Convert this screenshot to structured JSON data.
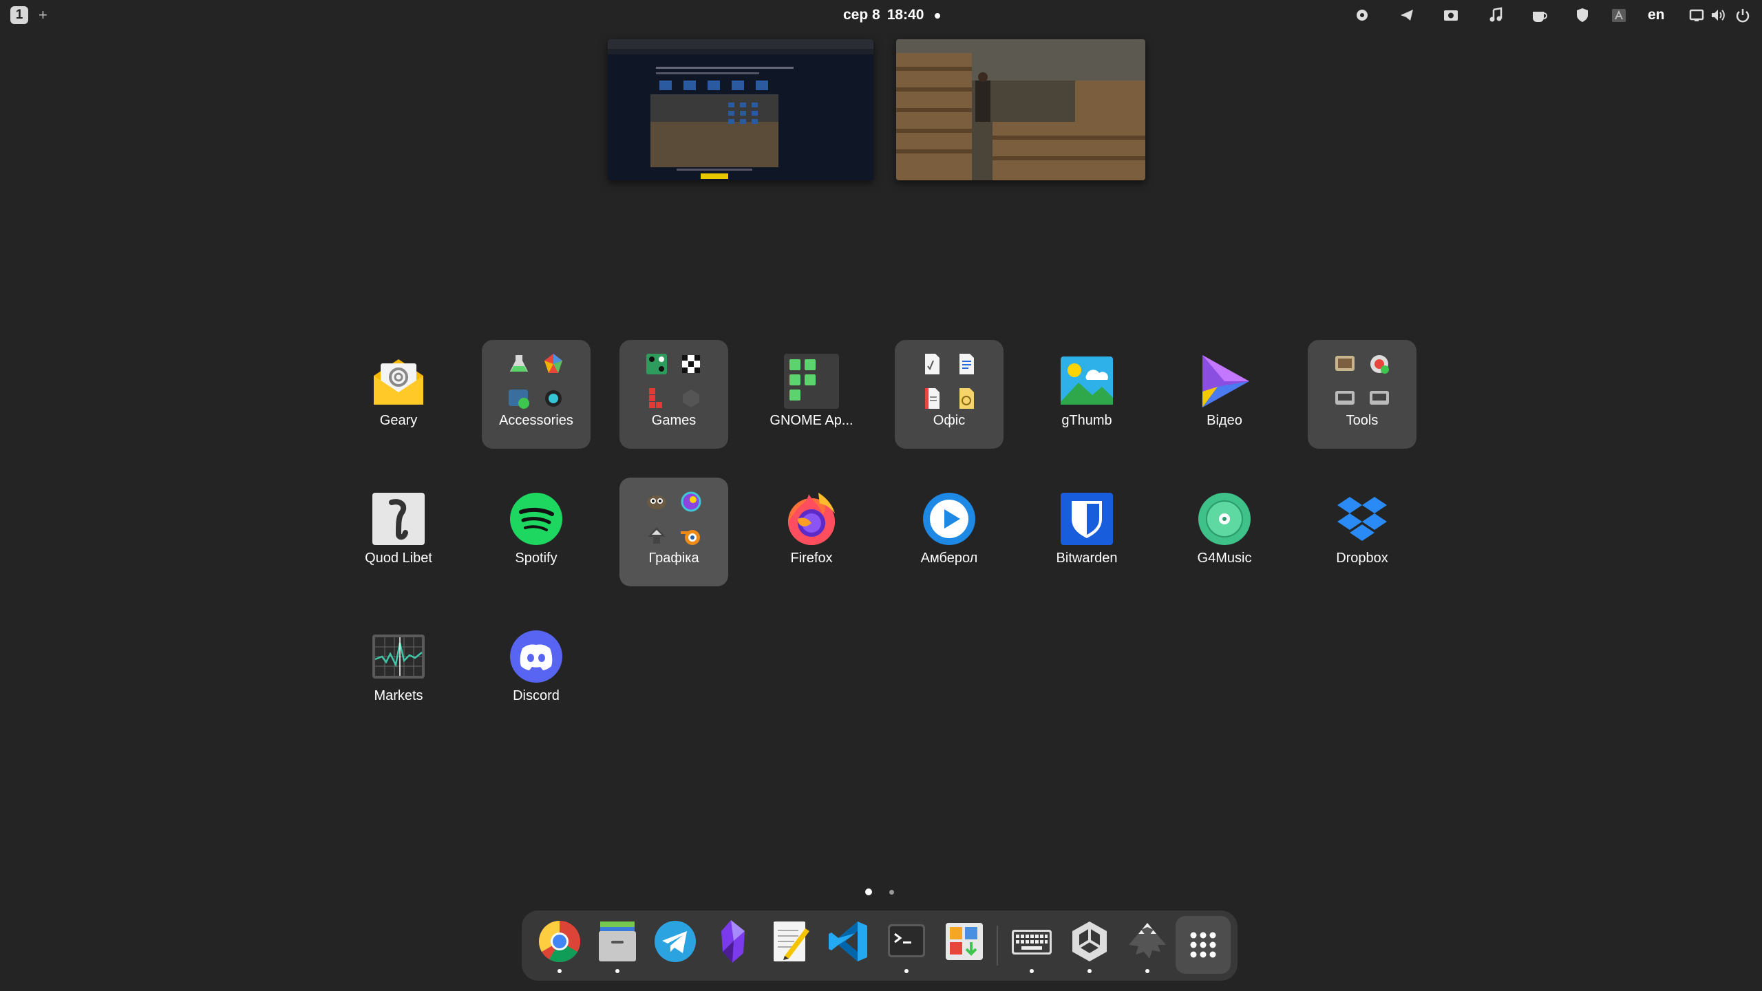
{
  "topbar": {
    "workspace": "1",
    "add": "+",
    "date": "сер 8",
    "time": "18:40",
    "lang": "en"
  },
  "apps": [
    {
      "label": "Geary",
      "icon": "geary-mail-icon",
      "folder": false
    },
    {
      "label": "Accessories",
      "icon": "accessories-folder-icon",
      "folder": true
    },
    {
      "label": "Games",
      "icon": "games-folder-icon",
      "folder": true
    },
    {
      "label": "GNOME Ap...",
      "icon": "gnome-apps-icon",
      "folder": false
    },
    {
      "label": "Офіс",
      "icon": "office-folder-icon",
      "folder": true
    },
    {
      "label": "gThumb",
      "icon": "gthumb-icon",
      "folder": false
    },
    {
      "label": "Відео",
      "icon": "video-player-icon",
      "folder": false
    },
    {
      "label": "Tools",
      "icon": "tools-folder-icon",
      "folder": true
    },
    {
      "label": "Quod Libet",
      "icon": "quod-libet-icon",
      "folder": false
    },
    {
      "label": "Spotify",
      "icon": "spotify-icon",
      "folder": false
    },
    {
      "label": "Графіка",
      "icon": "graphics-folder-icon",
      "folder": true
    },
    {
      "label": "Firefox",
      "icon": "firefox-icon",
      "folder": false
    },
    {
      "label": "Амберол",
      "icon": "amberol-icon",
      "folder": false
    },
    {
      "label": "Bitwarden",
      "icon": "bitwarden-icon",
      "folder": false
    },
    {
      "label": "G4Music",
      "icon": "g4music-icon",
      "folder": false
    },
    {
      "label": "Dropbox",
      "icon": "dropbox-icon",
      "folder": false
    },
    {
      "label": "Markets",
      "icon": "markets-icon",
      "folder": false
    },
    {
      "label": "Discord",
      "icon": "discord-icon",
      "folder": false
    }
  ],
  "dock": [
    {
      "icon": "chrome-icon",
      "running": true
    },
    {
      "icon": "files-icon",
      "running": true
    },
    {
      "icon": "telegram-icon",
      "running": false
    },
    {
      "icon": "obsidian-icon",
      "running": false
    },
    {
      "icon": "text-editor-icon",
      "running": false
    },
    {
      "icon": "vscode-icon",
      "running": false
    },
    {
      "icon": "terminal-icon",
      "running": true
    },
    {
      "icon": "software-center-icon",
      "running": false
    },
    {
      "icon": "keyboard-icon",
      "running": true
    },
    {
      "icon": "unity-icon",
      "running": true
    },
    {
      "icon": "inkscape-icon",
      "running": true
    },
    {
      "icon": "show-apps-grid-icon",
      "running": false
    }
  ],
  "pages": {
    "current": 1,
    "total": 2
  },
  "colors": {
    "background": "#242424",
    "folder": "#474747",
    "dock": "#383838"
  }
}
